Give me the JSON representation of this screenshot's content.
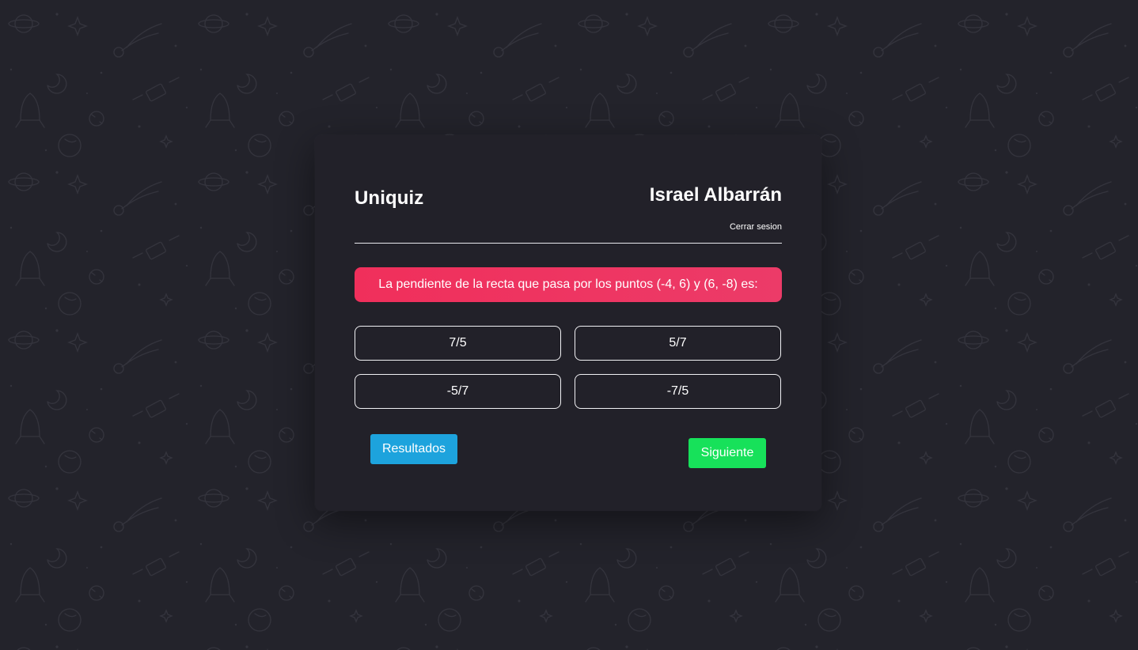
{
  "header": {
    "app_title": "Uniquiz",
    "user_name": "Israel Albarrán",
    "logout_label": "Cerrar sesion"
  },
  "quiz": {
    "question": "La pendiente de la recta que pasa por los puntos (-4, 6) y (6, -8) es:",
    "answers": [
      "7/5",
      "5/7",
      "-5/7",
      "-7/5"
    ]
  },
  "actions": {
    "results_label": "Resultados",
    "next_label": "Siguiente"
  },
  "colors": {
    "background": "#23232b",
    "card": "#222129",
    "question_bg": "#f02f5b",
    "results_button": "#1da3dd",
    "next_button": "#17e15a"
  },
  "icons": [
    "space-doodle-pattern"
  ]
}
